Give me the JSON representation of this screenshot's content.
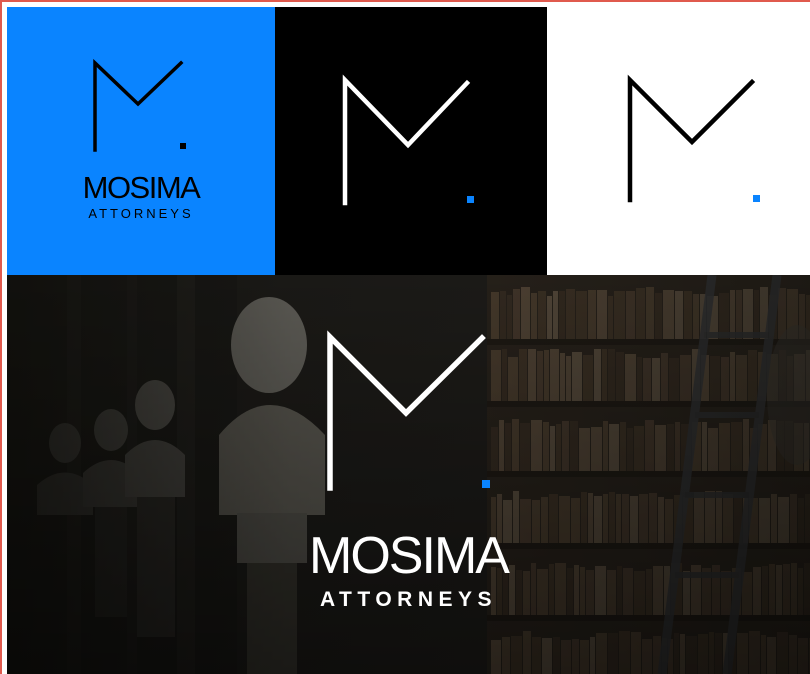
{
  "brand": {
    "name": "MOSIMA",
    "tagline": "ATTORNEYS",
    "monogram_icon": "m-monogram-logo-icon",
    "colors": {
      "blue": "#0a84ff",
      "black": "#000000",
      "white": "#ffffff",
      "dark_photo": "#24231f"
    }
  },
  "variants": [
    {
      "background": "blue",
      "mark_color": "#000000",
      "dot_color": "#000000",
      "shows_wordmark": true
    },
    {
      "background": "black",
      "mark_color": "#ffffff",
      "dot_color": "#0a84ff",
      "shows_wordmark": false
    },
    {
      "background": "white",
      "mark_color": "#000000",
      "dot_color": "#0a84ff",
      "shows_wordmark": false
    },
    {
      "background": "library-photo",
      "mark_color": "#ffffff",
      "dot_color": "#0a84ff",
      "shows_wordmark": true
    }
  ]
}
